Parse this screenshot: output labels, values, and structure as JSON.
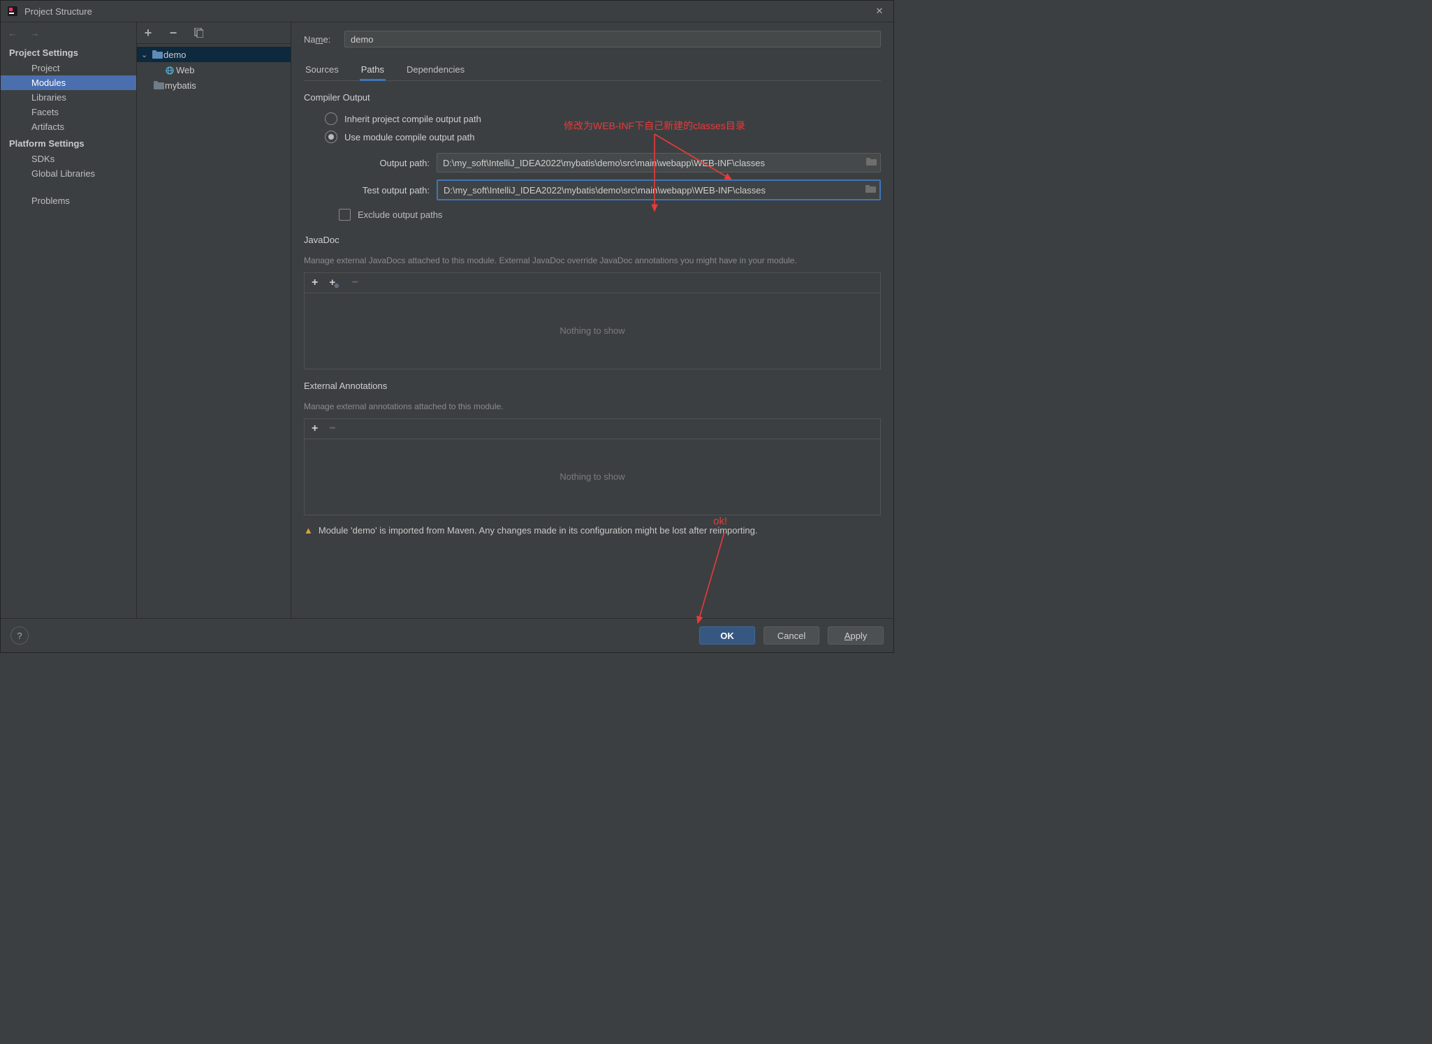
{
  "window": {
    "title": "Project Structure"
  },
  "sidebar": {
    "nav_back": "←",
    "nav_fwd": "→",
    "section1": "Project Settings",
    "items1": [
      "Project",
      "Modules",
      "Libraries",
      "Facets",
      "Artifacts"
    ],
    "section2": "Platform Settings",
    "items2": [
      "SDKs",
      "Global Libraries"
    ],
    "problems": "Problems"
  },
  "tree": {
    "root": "demo",
    "children": [
      "Web",
      "mybatis"
    ]
  },
  "content": {
    "name_label": "Name:",
    "name_value": "demo",
    "tabs": [
      "Sources",
      "Paths",
      "Dependencies"
    ],
    "compiler_output": "Compiler Output",
    "radio_inherit": "Inherit project compile output path",
    "radio_module": "Use module compile output path",
    "output_path_label": "Output path:",
    "output_path_value": "D:\\my_soft\\IntelliJ_IDEA2022\\mybatis\\demo\\src\\main\\webapp\\WEB-INF\\classes",
    "test_output_label": "Test output path:",
    "test_output_value": "D:\\my_soft\\IntelliJ_IDEA2022\\mybatis\\demo\\src\\main\\webapp\\WEB-INF\\classes",
    "exclude_label": "Exclude output paths",
    "javadoc_title": "JavaDoc",
    "javadoc_desc": "Manage external JavaDocs attached to this module. External JavaDoc override JavaDoc annotations you might have in your module.",
    "nothing": "Nothing to show",
    "ext_anno_title": "External Annotations",
    "ext_anno_desc": "Manage external annotations attached to this module.",
    "warning": "Module 'demo' is imported from Maven. Any changes made in its configuration might be lost after reimporting."
  },
  "annotations": {
    "top": "修改为WEB-INF下自己新建的classes目录",
    "ok": "ok!"
  },
  "footer": {
    "ok": "OK",
    "cancel": "Cancel",
    "apply": "Apply"
  },
  "colors": {
    "accent": "#3f75b8",
    "red": "#e83a3a"
  }
}
